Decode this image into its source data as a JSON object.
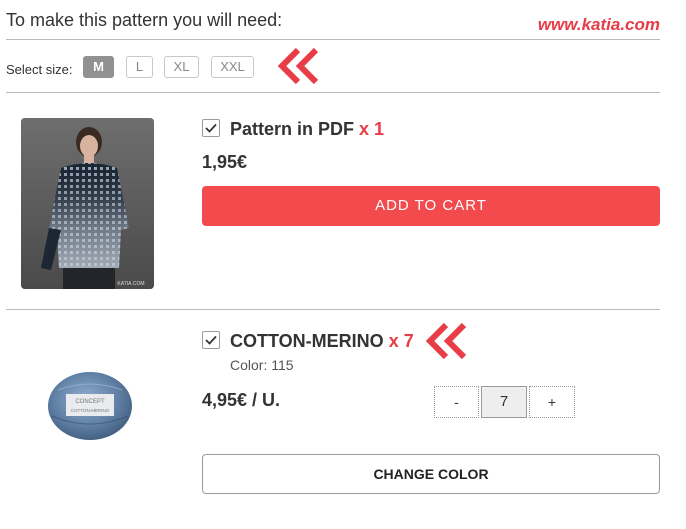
{
  "header": {
    "title": "To make this pattern you will need:",
    "watermark": "www.katia.com"
  },
  "size_selector": {
    "label": "Select size:",
    "options": [
      "M",
      "L",
      "XL",
      "XXL"
    ],
    "selected": "M"
  },
  "pattern_item": {
    "checked": true,
    "title": "Pattern in PDF",
    "quantity_label": "x 1",
    "price": "1,95€",
    "add_to_cart_label": "ADD TO CART",
    "image_caption": "KATIA.COM"
  },
  "yarn_item": {
    "checked": true,
    "title": "COTTON-MERINO",
    "quantity_label": "x 7",
    "color_label": "Color: 115",
    "price": "4,95€ / U.",
    "stepper": {
      "minus": "-",
      "value": "7",
      "plus": "+"
    },
    "change_color_label": "CHANGE COLOR",
    "image_brand": "CONCEPT",
    "image_product": "COTTON-MERINO"
  },
  "colors": {
    "accent": "#e83c47",
    "button_red": "#f24a4d",
    "size_active": "#919191",
    "divider": "#b9b9b9"
  },
  "icons": [
    "checkmark-icon",
    "double-chevron-left-icon"
  ]
}
